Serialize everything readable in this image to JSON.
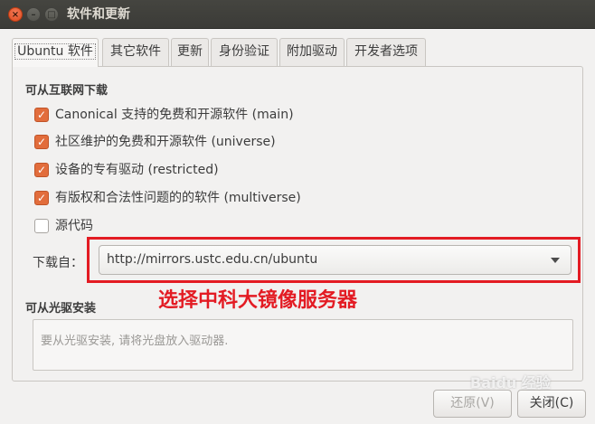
{
  "window": {
    "title": "软件和更新"
  },
  "tabs": [
    {
      "label": "Ubuntu 软件",
      "active": true
    },
    {
      "label": "其它软件"
    },
    {
      "label": "更新"
    },
    {
      "label": "身份验证"
    },
    {
      "label": "附加驱动"
    },
    {
      "label": "开发者选项"
    }
  ],
  "internet": {
    "title": "可从互联网下载",
    "options": [
      {
        "label": "Canonical 支持的免费和开源软件 (main)",
        "checked": true
      },
      {
        "label": "社区维护的免费和开源软件 (universe)",
        "checked": true
      },
      {
        "label": "设备的专有驱动 (restricted)",
        "checked": true
      },
      {
        "label": "有版权和合法性问题的的软件 (multiverse)",
        "checked": true
      },
      {
        "label": "源代码",
        "checked": false
      }
    ],
    "download_from_label": "下载自：",
    "download_from_value": "http://mirrors.ustc.edu.cn/ubuntu"
  },
  "annotation": "选择中科大镜像服务器",
  "cdrom": {
    "title": "可从光驱安装",
    "placeholder": "要从光驱安装, 请将光盘放入驱动器."
  },
  "buttons": {
    "revert": "还原(V)",
    "close": "关闭(C)"
  },
  "watermark": "Baidu 经验",
  "colors": {
    "checkbox": "#e26d3c",
    "annotation": "#e31b23",
    "titlebar": "#3b3b37"
  }
}
